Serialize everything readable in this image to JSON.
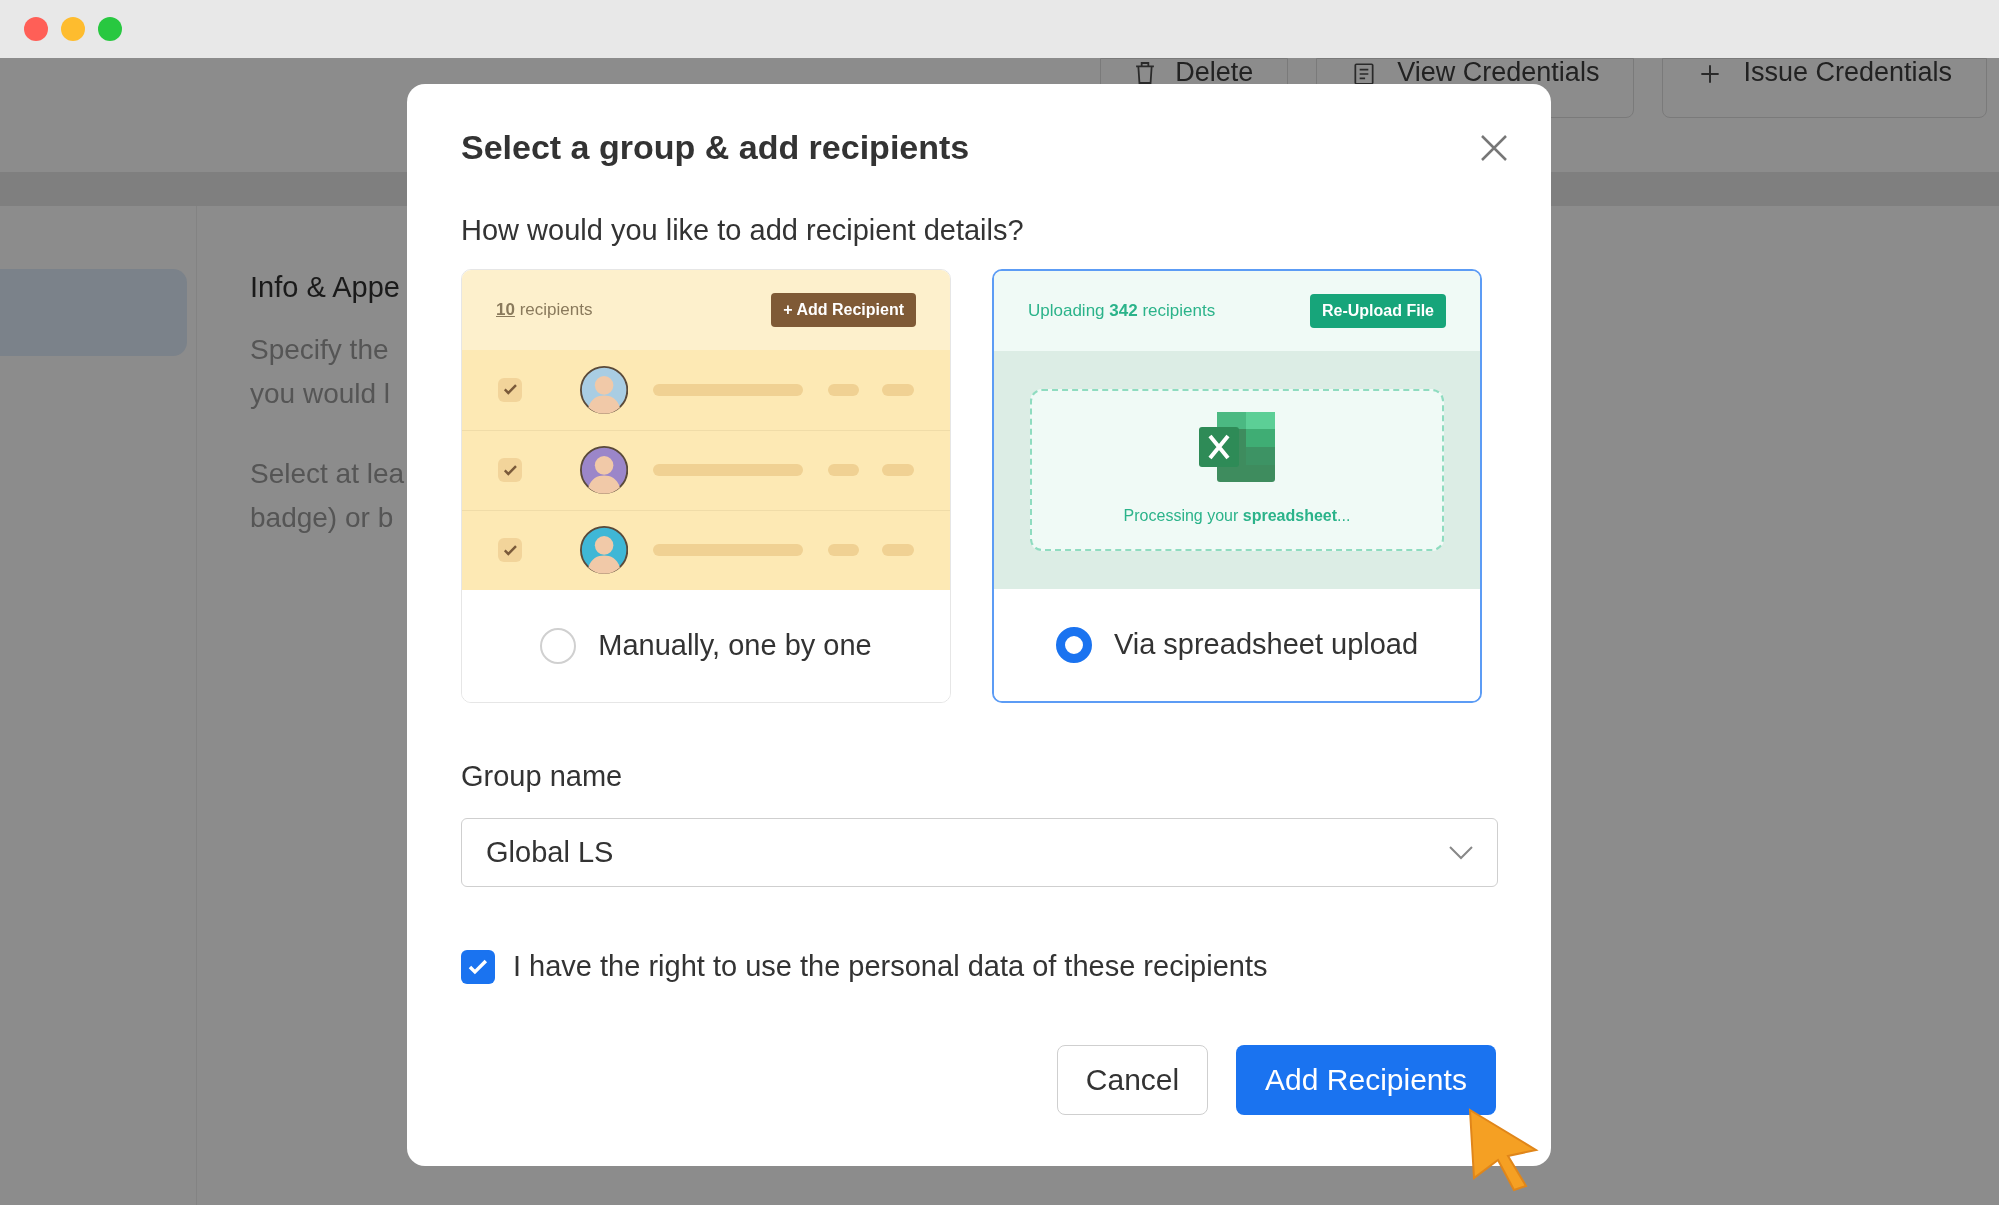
{
  "window": {
    "controls": [
      {
        "color": "#ff5f57"
      },
      {
        "color": "#febc2e"
      },
      {
        "color": "#28c840"
      }
    ]
  },
  "toolbar": {
    "buttons": [
      {
        "label": "Delete",
        "kind": "delete"
      },
      {
        "label": "View Credentials",
        "kind": "view"
      },
      {
        "label": "Issue Credentials",
        "kind": "issue"
      }
    ]
  },
  "section": {
    "title": "Info & Appe",
    "paragraphs": [
      [
        "Specify the",
        "you would l"
      ],
      [
        "Select at lea",
        "badge) or b"
      ]
    ]
  },
  "dialog": {
    "title": "Select a group & add recipients",
    "question": "How would you like to add recipient details?",
    "options": [
      {
        "kind": "manual",
        "label": "Manually, one by one",
        "selected": false,
        "header": "**10** recipients",
        "action": "+ Add Recipient",
        "rows": [
          {
            "checked": true,
            "color": "#a9cde3"
          },
          {
            "checked": true,
            "color": "#9b86c9"
          },
          {
            "checked": true,
            "color": "#3fb7d6"
          }
        ]
      },
      {
        "kind": "upload",
        "label": "Via spreadsheet upload",
        "selected": true,
        "header": "Uploading **342** recipients",
        "action": "Re-Upload File",
        "status": "Processing your **spreadsheet**..."
      }
    ],
    "group_label": "Group name",
    "group_value": "Global LS",
    "consent": {
      "label": "I have the right to use the personal data of these recipients",
      "checked": true
    },
    "buttons": [
      {
        "label": "Cancel",
        "kind": "secondary"
      },
      {
        "label": "Add Recipients",
        "kind": "primary"
      }
    ]
  }
}
